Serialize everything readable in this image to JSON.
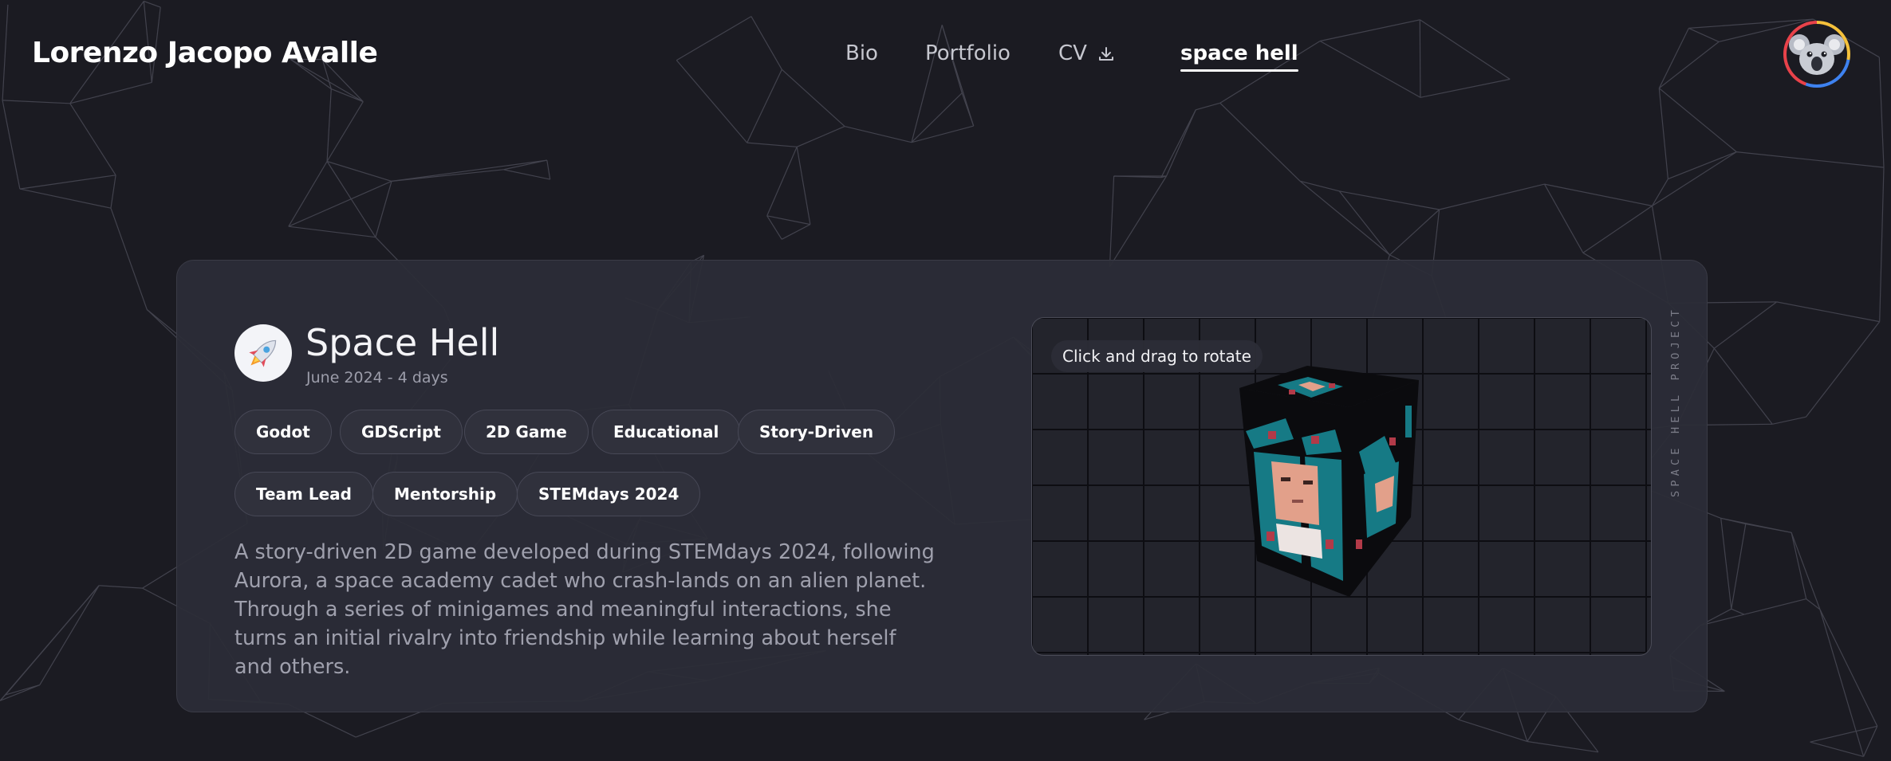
{
  "header": {
    "site_title": "Lorenzo Jacopo Avalle",
    "nav": [
      {
        "label": "Bio",
        "active": false
      },
      {
        "label": "Portfolio",
        "active": false
      },
      {
        "label": "CV",
        "active": false,
        "icon": "download-icon"
      },
      {
        "label": "space hell",
        "active": true
      }
    ],
    "avatar": {
      "icon": "koala-avatar",
      "ring_colors": [
        "#f5c13b",
        "#3e82f0",
        "#e9424a"
      ]
    }
  },
  "project": {
    "icon": "rocket-icon",
    "title": "Space Hell",
    "date": "June 2024 - 4 days",
    "tags": [
      "Godot",
      "GDScript",
      "2D Game",
      "Educational",
      "Story-Driven",
      "Team Lead",
      "Mentorship",
      "STEMdays 2024"
    ],
    "description": "A story-driven 2D game developed during STEMdays 2024, following Aurora, a space academy cadet who crash-lands on an alien planet. Through a series of minigames and meaningful interactions, she turns an initial rivalry into friendship while learning about herself and others.",
    "viewer_hint": "Click and drag to rotate",
    "vertical_label": "SPACE HELL PROJECT"
  },
  "colors": {
    "background": "#1b1b22",
    "card": "#2c2d37",
    "tag_bg": "#30313c",
    "cube_teal": "#167a85",
    "cube_skin": "#e2a08a",
    "cube_red": "#b23a48"
  }
}
